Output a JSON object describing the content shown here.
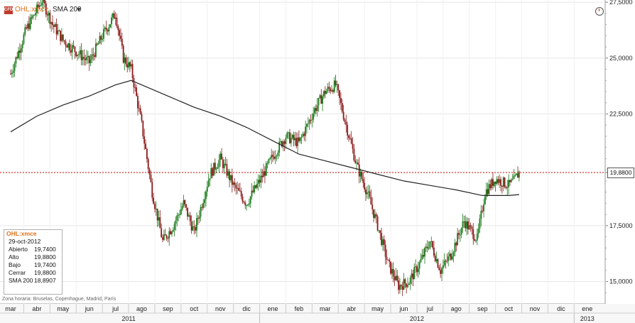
{
  "header": {
    "badge": "CFD",
    "symbol": "OHL:xmce",
    "indicator": "SMA 200",
    "indicator_caret": "▼"
  },
  "timezone_note": "Zona horaria: Bruselas, Copenhague, Madrid, París",
  "info_box": {
    "title": "OHL:xmce",
    "date": "29-oct-2012",
    "rows": [
      {
        "label": "Abierto",
        "value": "19,7400"
      },
      {
        "label": "Alto",
        "value": "19,8800"
      },
      {
        "label": "Bajo",
        "value": "19,7400"
      },
      {
        "label": "Cerrar",
        "value": "19,8800"
      },
      {
        "label": "SMA 200",
        "value": "18,8907"
      }
    ]
  },
  "last_price_label": "19,8800",
  "colors": {
    "up": "#1a7a1a",
    "down": "#8b1a1a",
    "sma": "#222222",
    "ref_line": "#d00000",
    "grid": "#e6e6e6",
    "symbol_text": "#e0701a"
  },
  "chart_data": {
    "type": "candlestick",
    "series_name": "OHL:xmce",
    "x_months": [
      "mar",
      "abr",
      "may",
      "jun",
      "jul",
      "ago",
      "sep",
      "oct",
      "nov",
      "dic",
      "ene",
      "feb",
      "mar",
      "abr",
      "may",
      "jun",
      "jul",
      "ago",
      "sep",
      "oct",
      "nov",
      "dic",
      "ene"
    ],
    "years": [
      "2011",
      "2012",
      "2013"
    ],
    "y_ticks": [
      "27,5000",
      "25,0000",
      "22,5000",
      "19,8800",
      "17,5000",
      "15,0000"
    ],
    "y_tick_values": [
      27.5,
      25.0,
      22.5,
      19.88,
      17.5,
      15.0
    ],
    "ylim": [
      14.0,
      27.6
    ],
    "reference_line": 19.88,
    "price_path": [
      {
        "month": 0.0,
        "price": 24.3
      },
      {
        "month": 0.6,
        "price": 26.3
      },
      {
        "month": 1.2,
        "price": 27.6
      },
      {
        "month": 1.6,
        "price": 26.5
      },
      {
        "month": 2.0,
        "price": 25.8
      },
      {
        "month": 2.5,
        "price": 25.3
      },
      {
        "month": 3.0,
        "price": 24.8
      },
      {
        "month": 3.5,
        "price": 26.0
      },
      {
        "month": 4.0,
        "price": 27.0
      },
      {
        "month": 4.3,
        "price": 25.0
      },
      {
        "month": 4.6,
        "price": 24.5
      },
      {
        "month": 5.0,
        "price": 22.0
      },
      {
        "month": 5.4,
        "price": 19.0
      },
      {
        "month": 5.8,
        "price": 16.8
      },
      {
        "month": 6.2,
        "price": 17.5
      },
      {
        "month": 6.6,
        "price": 18.5
      },
      {
        "month": 7.0,
        "price": 17.2
      },
      {
        "month": 7.6,
        "price": 19.8
      },
      {
        "month": 8.0,
        "price": 20.5
      },
      {
        "month": 8.5,
        "price": 19.3
      },
      {
        "month": 9.0,
        "price": 18.5
      },
      {
        "month": 9.5,
        "price": 19.5
      },
      {
        "month": 10.0,
        "price": 20.6
      },
      {
        "month": 10.5,
        "price": 21.5
      },
      {
        "month": 11.0,
        "price": 21.2
      },
      {
        "month": 11.6,
        "price": 22.7
      },
      {
        "month": 12.0,
        "price": 23.5
      },
      {
        "month": 12.4,
        "price": 23.8
      },
      {
        "month": 12.8,
        "price": 22.0
      },
      {
        "month": 13.2,
        "price": 20.2
      },
      {
        "month": 13.6,
        "price": 19.0
      },
      {
        "month": 14.0,
        "price": 17.5
      },
      {
        "month": 14.4,
        "price": 15.8
      },
      {
        "month": 14.8,
        "price": 14.8
      },
      {
        "month": 15.2,
        "price": 15.0
      },
      {
        "month": 15.6,
        "price": 15.8
      },
      {
        "month": 16.0,
        "price": 16.8
      },
      {
        "month": 16.4,
        "price": 15.5
      },
      {
        "month": 16.8,
        "price": 16.2
      },
      {
        "month": 17.3,
        "price": 17.7
      },
      {
        "month": 17.8,
        "price": 16.9
      },
      {
        "month": 18.1,
        "price": 19.0
      },
      {
        "month": 18.5,
        "price": 19.6
      },
      {
        "month": 19.0,
        "price": 19.3
      },
      {
        "month": 19.2,
        "price": 19.5
      },
      {
        "month": 19.4,
        "price": 19.88
      }
    ],
    "sma_path": [
      {
        "month": 0.0,
        "price": 21.7
      },
      {
        "month": 1.0,
        "price": 22.4
      },
      {
        "month": 2.0,
        "price": 22.9
      },
      {
        "month": 3.0,
        "price": 23.3
      },
      {
        "month": 4.0,
        "price": 23.8
      },
      {
        "month": 4.6,
        "price": 24.0
      },
      {
        "month": 5.0,
        "price": 23.8
      },
      {
        "month": 6.0,
        "price": 23.3
      },
      {
        "month": 7.0,
        "price": 22.8
      },
      {
        "month": 8.0,
        "price": 22.4
      },
      {
        "month": 9.0,
        "price": 21.9
      },
      {
        "month": 10.0,
        "price": 21.3
      },
      {
        "month": 11.0,
        "price": 20.7
      },
      {
        "month": 12.0,
        "price": 20.4
      },
      {
        "month": 13.0,
        "price": 20.1
      },
      {
        "month": 14.0,
        "price": 19.8
      },
      {
        "month": 15.0,
        "price": 19.5
      },
      {
        "month": 16.0,
        "price": 19.3
      },
      {
        "month": 17.0,
        "price": 19.1
      },
      {
        "month": 18.0,
        "price": 18.85
      },
      {
        "month": 19.0,
        "price": 18.85
      },
      {
        "month": 19.4,
        "price": 18.89
      }
    ]
  }
}
